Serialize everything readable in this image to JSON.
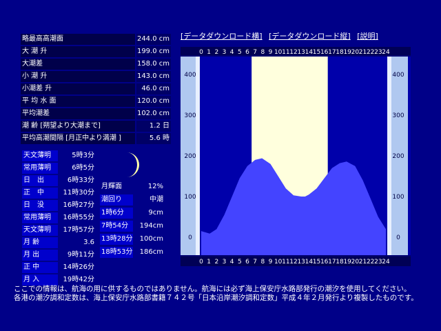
{
  "links": [
    "[データダウンロード横]",
    "[データダウンロード縦]",
    "[説明]"
  ],
  "stats": [
    {
      "label": "略最高高潮面",
      "value": "244.0 cm"
    },
    {
      "label": "大 潮 升",
      "value": "199.0 cm"
    },
    {
      "label": "大潮差",
      "value": "158.0 cm"
    },
    {
      "label": "小 潮 升",
      "value": "143.0 cm"
    },
    {
      "label": "小潮差 升",
      "value": "46.0 cm"
    },
    {
      "label": "平 均 水 面",
      "value": "120.0 cm"
    },
    {
      "label": "平均潮差",
      "value": "102.0 cm"
    },
    {
      "label": "潮 齢 [朔望より大潮まで]",
      "value": "1.2 日"
    },
    {
      "label": "平均高潮間隔 [月正中より満潮 ]",
      "value": "5.6 時"
    }
  ],
  "daily": [
    {
      "label": "天文薄明",
      "value": "5時3分"
    },
    {
      "label": "常用薄明",
      "value": "6時5分"
    },
    {
      "label": "日　出",
      "value": "6時33分"
    },
    {
      "label": "正　中",
      "value": "11時30分"
    },
    {
      "label": "日　没",
      "value": "16時27分"
    },
    {
      "label": "常用薄明",
      "value": "16時55分"
    },
    {
      "label": "天文薄明",
      "value": "17時57分"
    },
    {
      "label": "月 齢",
      "value": "3.6"
    },
    {
      "label": "月 出",
      "value": "9時11分"
    },
    {
      "label": "正 中",
      "value": "14時26分"
    },
    {
      "label": "月 入",
      "value": "19時42分"
    }
  ],
  "moon": [
    {
      "label": "月輝面",
      "value": "12%"
    },
    {
      "label": "潮回り",
      "value": "中潮"
    },
    {
      "label": "1時6分",
      "value": "9cm"
    },
    {
      "label": "7時54分",
      "value": "194cm"
    },
    {
      "label": "13時28分",
      "value": "100cm"
    },
    {
      "label": "18時53分",
      "value": "186cm"
    }
  ],
  "footer": [
    "ここでの情報は、航海の用に供するものではありません。航海には必ず海上保安庁水路部発行の潮汐を使用してください。",
    "各港の潮汐調和定数は、海上保安庁水路部書籍７４２号「日本沿岸潮汐調和定数」平成４年２月発行より複製したものです。"
  ],
  "colors": {
    "background": "#000088",
    "tide_fill": "#4444ff",
    "daylight": "#ffffdd",
    "ruler": "#b0c8f0"
  },
  "chart_data": {
    "type": "area",
    "x_ticks": [
      "0",
      "1",
      "2",
      "3",
      "4",
      "5",
      "6",
      "7",
      "8",
      "9",
      "10",
      "11",
      "12",
      "13",
      "14",
      "15",
      "16",
      "17",
      "18",
      "19",
      "20",
      "21",
      "22",
      "23",
      "24"
    ],
    "y_ticks": [
      "0",
      "100",
      "200",
      "300",
      "400"
    ],
    "xlim": [
      0,
      24
    ],
    "ylim": [
      -20,
      450
    ],
    "x": [
      0,
      1.1,
      2,
      3,
      4,
      5,
      6,
      7,
      7.9,
      9,
      10,
      11,
      12,
      13,
      13.5,
      14,
      15,
      16,
      17,
      18,
      18.9,
      20,
      21,
      22,
      23,
      24
    ],
    "values": [
      15,
      9,
      20,
      55,
      100,
      145,
      175,
      190,
      194,
      180,
      150,
      120,
      103,
      100,
      100,
      105,
      120,
      145,
      170,
      182,
      186,
      175,
      140,
      95,
      50,
      20
    ],
    "daylight_range": [
      6.55,
      16.45
    ],
    "extremes": [
      {
        "time": "1時6分",
        "height": 9
      },
      {
        "time": "7時54分",
        "height": 194
      },
      {
        "time": "13時28分",
        "height": 100
      },
      {
        "time": "18時53分",
        "height": 186
      }
    ]
  }
}
